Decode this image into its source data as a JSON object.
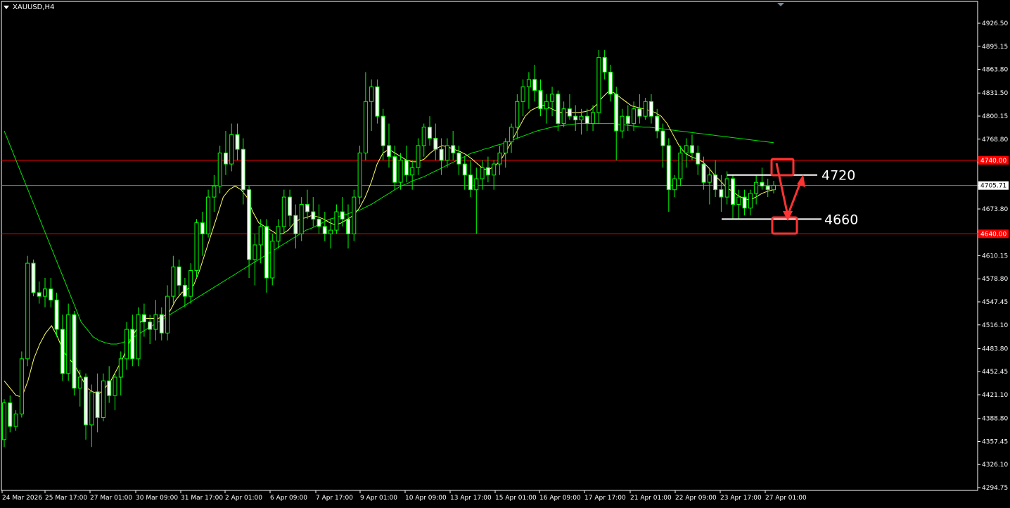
{
  "window": {
    "symbol_label": "XAUUSD,H4"
  },
  "chart_data": {
    "type": "candlestick",
    "symbol": "XAUUSD",
    "timeframe": "H4",
    "ylim": [
      4294.75,
      4926.5
    ],
    "y_ticks": [
      "4926.50",
      "4895.15",
      "4863.80",
      "4831.50",
      "4800.15",
      "4768.80",
      "4737.45",
      "4705.71",
      "4673.80",
      "4642.45",
      "4610.15",
      "4578.80",
      "4547.45",
      "4516.10",
      "4483.80",
      "4452.45",
      "4421.10",
      "4388.80",
      "4357.45",
      "4326.10",
      "4294.75"
    ],
    "x_ticks": [
      "24 Mar 2026",
      "25 Mar 17:00",
      "27 Mar 01:00",
      "30 Mar 09:00",
      "31 Mar 17:00",
      "2 Apr 01:00",
      "6 Apr 09:00",
      "7 Apr 17:00",
      "9 Apr 01:00",
      "10 Apr 09:00",
      "13 Apr 17:00",
      "15 Apr 01:00",
      "16 Apr 09:00",
      "17 Apr 17:00",
      "21 Apr 01:00",
      "22 Apr 09:00",
      "23 Apr 17:00",
      "27 Apr 01:00"
    ],
    "current_price": "4705.71",
    "resistance_line": {
      "label": "4740.00",
      "value": 4740.0,
      "color": "#ff0000"
    },
    "support_line": {
      "label": "4640.00",
      "value": 4640.0,
      "color": "#ff0000"
    },
    "annotations": [
      {
        "text": "4720",
        "value": 4720
      },
      {
        "text": "4660",
        "value": 4660
      }
    ],
    "colors": {
      "background": "#000000",
      "candle": "#00ff00",
      "bull_body": "#000000",
      "bear_body": "#ffffff",
      "ma_fast": "#ffff66",
      "ma_slow": "#00e600",
      "axis_text": "#ffffff",
      "current_price_line": "#708090",
      "marker_box": "#ff3333"
    },
    "candles": [
      [
        4360,
        4415,
        4350,
        4410
      ],
      [
        4410,
        4420,
        4370,
        4378
      ],
      [
        4378,
        4400,
        4372,
        4395
      ],
      [
        4395,
        4480,
        4390,
        4470
      ],
      [
        4470,
        4610,
        4460,
        4600
      ],
      [
        4600,
        4605,
        4555,
        4560
      ],
      [
        4560,
        4575,
        4545,
        4555
      ],
      [
        4555,
        4580,
        4540,
        4565
      ],
      [
        4565,
        4580,
        4540,
        4550
      ],
      [
        4550,
        4560,
        4500,
        4510
      ],
      [
        4510,
        4530,
        4440,
        4450
      ],
      [
        4450,
        4545,
        4440,
        4530
      ],
      [
        4530,
        4535,
        4420,
        4430
      ],
      [
        4430,
        4455,
        4405,
        4445
      ],
      [
        4445,
        4450,
        4360,
        4380
      ],
      [
        4380,
        4435,
        4350,
        4425
      ],
      [
        4425,
        4450,
        4370,
        4390
      ],
      [
        4390,
        4450,
        4385,
        4440
      ],
      [
        4440,
        4460,
        4410,
        4420
      ],
      [
        4420,
        4450,
        4400,
        4445
      ],
      [
        4445,
        4480,
        4420,
        4470
      ],
      [
        4470,
        4520,
        4455,
        4510
      ],
      [
        4510,
        4530,
        4460,
        4470
      ],
      [
        4470,
        4540,
        4460,
        4530
      ],
      [
        4530,
        4545,
        4500,
        4520
      ],
      [
        4520,
        4530,
        4490,
        4510
      ],
      [
        4510,
        4550,
        4495,
        4530
      ],
      [
        4530,
        4540,
        4495,
        4505
      ],
      [
        4505,
        4570,
        4495,
        4555
      ],
      [
        4555,
        4610,
        4545,
        4595
      ],
      [
        4595,
        4605,
        4555,
        4570
      ],
      [
        4570,
        4580,
        4540,
        4555
      ],
      [
        4555,
        4600,
        4545,
        4590
      ],
      [
        4590,
        4660,
        4580,
        4655
      ],
      [
        4655,
        4670,
        4610,
        4640
      ],
      [
        4640,
        4700,
        4635,
        4690
      ],
      [
        4690,
        4720,
        4670,
        4705
      ],
      [
        4705,
        4760,
        4695,
        4750
      ],
      [
        4750,
        4780,
        4720,
        4735
      ],
      [
        4735,
        4790,
        4725,
        4775
      ],
      [
        4775,
        4790,
        4740,
        4755
      ],
      [
        4755,
        4770,
        4680,
        4700
      ],
      [
        4700,
        4705,
        4580,
        4605
      ],
      [
        4605,
        4640,
        4570,
        4625
      ],
      [
        4625,
        4660,
        4600,
        4650
      ],
      [
        4650,
        4660,
        4560,
        4580
      ],
      [
        4580,
        4640,
        4570,
        4630
      ],
      [
        4630,
        4660,
        4620,
        4650
      ],
      [
        4650,
        4700,
        4640,
        4690
      ],
      [
        4690,
        4700,
        4650,
        4665
      ],
      [
        4665,
        4680,
        4620,
        4640
      ],
      [
        4640,
        4690,
        4630,
        4680
      ],
      [
        4680,
        4700,
        4660,
        4670
      ],
      [
        4670,
        4690,
        4650,
        4660
      ],
      [
        4660,
        4680,
        4640,
        4650
      ],
      [
        4650,
        4670,
        4630,
        4640
      ],
      [
        4640,
        4660,
        4620,
        4645
      ],
      [
        4645,
        4680,
        4640,
        4670
      ],
      [
        4670,
        4690,
        4650,
        4660
      ],
      [
        4660,
        4680,
        4620,
        4640
      ],
      [
        4640,
        4700,
        4630,
        4690
      ],
      [
        4690,
        4760,
        4680,
        4750
      ],
      [
        4750,
        4860,
        4740,
        4820
      ],
      [
        4820,
        4850,
        4780,
        4840
      ],
      [
        4840,
        4850,
        4790,
        4800
      ],
      [
        4800,
        4810,
        4740,
        4760
      ],
      [
        4760,
        4790,
        4730,
        4745
      ],
      [
        4745,
        4760,
        4700,
        4710
      ],
      [
        4710,
        4750,
        4700,
        4740
      ],
      [
        4740,
        4760,
        4710,
        4720
      ],
      [
        4720,
        4740,
        4700,
        4730
      ],
      [
        4730,
        4770,
        4720,
        4760
      ],
      [
        4760,
        4790,
        4745,
        4785
      ],
      [
        4785,
        4800,
        4760,
        4770
      ],
      [
        4770,
        4790,
        4740,
        4755
      ],
      [
        4755,
        4770,
        4720,
        4740
      ],
      [
        4740,
        4770,
        4730,
        4760
      ],
      [
        4760,
        4780,
        4740,
        4750
      ],
      [
        4750,
        4760,
        4720,
        4735
      ],
      [
        4735,
        4745,
        4700,
        4720
      ],
      [
        4720,
        4740,
        4690,
        4700
      ],
      [
        4700,
        4730,
        4640,
        4715
      ],
      [
        4715,
        4740,
        4700,
        4730
      ],
      [
        4730,
        4745,
        4710,
        4720
      ],
      [
        4720,
        4740,
        4700,
        4735
      ],
      [
        4735,
        4760,
        4720,
        4750
      ],
      [
        4750,
        4770,
        4730,
        4765
      ],
      [
        4765,
        4790,
        4750,
        4785
      ],
      [
        4785,
        4830,
        4770,
        4820
      ],
      [
        4820,
        4850,
        4800,
        4840
      ],
      [
        4840,
        4860,
        4810,
        4850
      ],
      [
        4850,
        4870,
        4820,
        4835
      ],
      [
        4835,
        4850,
        4800,
        4810
      ],
      [
        4810,
        4830,
        4790,
        4820
      ],
      [
        4820,
        4840,
        4800,
        4830
      ],
      [
        4830,
        4835,
        4780,
        4790
      ],
      [
        4790,
        4820,
        4785,
        4810
      ],
      [
        4810,
        4830,
        4795,
        4800
      ],
      [
        4800,
        4815,
        4780,
        4795
      ],
      [
        4795,
        4810,
        4775,
        4800
      ],
      [
        4800,
        4810,
        4780,
        4790
      ],
      [
        4790,
        4815,
        4780,
        4805
      ],
      [
        4805,
        4890,
        4790,
        4880
      ],
      [
        4880,
        4890,
        4850,
        4860
      ],
      [
        4860,
        4870,
        4820,
        4830
      ],
      [
        4830,
        4840,
        4740,
        4780
      ],
      [
        4780,
        4810,
        4770,
        4800
      ],
      [
        4800,
        4815,
        4780,
        4790
      ],
      [
        4790,
        4820,
        4780,
        4810
      ],
      [
        4810,
        4830,
        4790,
        4800
      ],
      [
        4800,
        4825,
        4795,
        4820
      ],
      [
        4820,
        4830,
        4790,
        4800
      ],
      [
        4800,
        4810,
        4770,
        4780
      ],
      [
        4780,
        4790,
        4730,
        4760
      ],
      [
        4760,
        4770,
        4670,
        4700
      ],
      [
        4700,
        4720,
        4690,
        4715
      ],
      [
        4715,
        4760,
        4705,
        4750
      ],
      [
        4750,
        4770,
        4730,
        4760
      ],
      [
        4760,
        4775,
        4740,
        4750
      ],
      [
        4750,
        4760,
        4720,
        4735
      ],
      [
        4735,
        4745,
        4700,
        4710
      ],
      [
        4710,
        4730,
        4680,
        4720
      ],
      [
        4720,
        4740,
        4690,
        4700
      ],
      [
        4700,
        4720,
        4670,
        4690
      ],
      [
        4690,
        4725,
        4680,
        4715
      ],
      [
        4715,
        4720,
        4660,
        4680
      ],
      [
        4680,
        4700,
        4660,
        4690
      ],
      [
        4690,
        4700,
        4665,
        4675
      ],
      [
        4675,
        4700,
        4665,
        4695
      ],
      [
        4695,
        4720,
        4680,
        4710
      ],
      [
        4710,
        4730,
        4700,
        4705
      ],
      [
        4705,
        4715,
        4690,
        4700
      ],
      [
        4700,
        4712,
        4695,
        4706
      ]
    ],
    "ma_fast": [
      4440,
      4430,
      4420,
      4418,
      4440,
      4470,
      4490,
      4505,
      4515,
      4500,
      4480,
      4470,
      4460,
      4445,
      4430,
      4425,
      4422,
      4430,
      4440,
      4455,
      4470,
      4490,
      4505,
      4520,
      4525,
      4525,
      4525,
      4528,
      4535,
      4550,
      4560,
      4565,
      4570,
      4590,
      4615,
      4640,
      4665,
      4690,
      4700,
      4705,
      4700,
      4690,
      4670,
      4655,
      4650,
      4645,
      4640,
      4640,
      4645,
      4655,
      4660,
      4662,
      4665,
      4663,
      4660,
      4655,
      4652,
      4655,
      4660,
      4665,
      4675,
      4690,
      4710,
      4735,
      4750,
      4755,
      4750,
      4745,
      4740,
      4738,
      4738,
      4742,
      4750,
      4756,
      4760,
      4758,
      4755,
      4752,
      4748,
      4742,
      4735,
      4728,
      4728,
      4733,
      4742,
      4755,
      4770,
      4785,
      4800,
      4808,
      4812,
      4815,
      4812,
      4808,
      4805,
      4805,
      4805,
      4805,
      4806,
      4808,
      4815,
      4825,
      4833,
      4832,
      4826,
      4820,
      4814,
      4812,
      4810,
      4808,
      4805,
      4800,
      4790,
      4775,
      4760,
      4750,
      4745,
      4742,
      4738,
      4730,
      4720,
      4712,
      4703,
      4698,
      4692,
      4688,
      4686,
      4690,
      4695,
      4698,
      4700
    ],
    "ma_slow": [
      4780,
      4760,
      4740,
      4720,
      4700,
      4680,
      4660,
      4640,
      4620,
      4600,
      4580,
      4560,
      4540,
      4520,
      4510,
      4500,
      4495,
      4492,
      4490,
      4490,
      4492,
      4495,
      4500,
      4505,
      4510,
      4515,
      4520,
      4525,
      4530,
      4535,
      4540,
      4545,
      4550,
      4555,
      4560,
      4565,
      4570,
      4575,
      4580,
      4585,
      4590,
      4595,
      4600,
      4605,
      4610,
      4615,
      4620,
      4625,
      4630,
      4635,
      4640,
      4645,
      4648,
      4652,
      4656,
      4660,
      4662,
      4665,
      4667,
      4670,
      4672,
      4676,
      4680,
      4685,
      4690,
      4695,
      4700,
      4705,
      4708,
      4712,
      4715,
      4718,
      4722,
      4726,
      4730,
      4734,
      4738,
      4742,
      4746,
      4750,
      4752,
      4755,
      4757,
      4760,
      4762,
      4765,
      4768,
      4771,
      4774,
      4777,
      4780,
      4782,
      4784,
      4786,
      4787,
      4788,
      4789,
      4790,
      4790,
      4790,
      4790,
      4790,
      4790,
      4790,
      4789,
      4788,
      4787,
      4786,
      4785,
      4785,
      4784,
      4783,
      4782,
      4781,
      4780,
      4779,
      4778,
      4777,
      4776,
      4775,
      4774,
      4773,
      4772,
      4771,
      4770,
      4769,
      4768,
      4767,
      4766,
      4765,
      4764
    ]
  }
}
